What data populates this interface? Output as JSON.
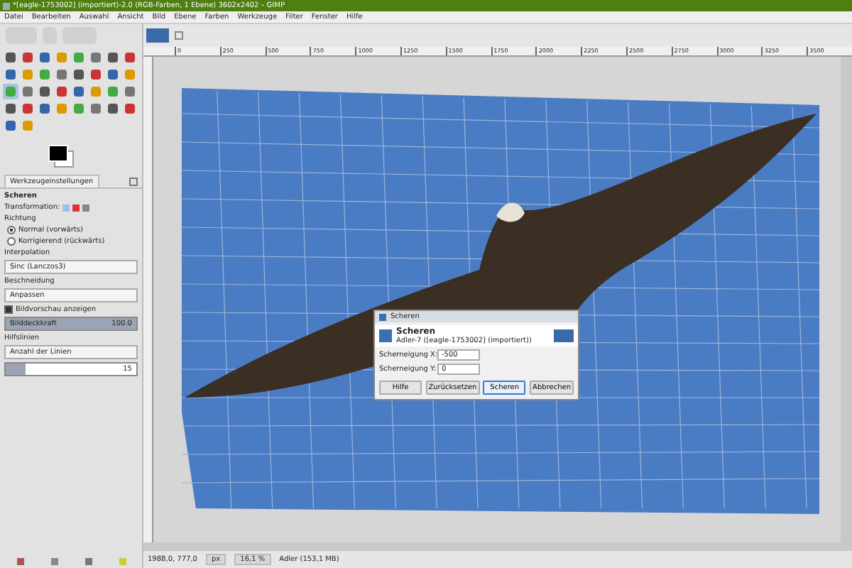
{
  "window": {
    "title": "*[eagle-1753002] (importiert)-2.0 (RGB-Farben, 1 Ebene) 3602x2402 – GIMP"
  },
  "menu": [
    "Datei",
    "Bearbeiten",
    "Auswahl",
    "Ansicht",
    "Bild",
    "Ebene",
    "Farben",
    "Werkzeuge",
    "Filter",
    "Fenster",
    "Hilfe"
  ],
  "tools": [
    {
      "selected": false
    },
    {
      "selected": false
    },
    {
      "selected": false
    },
    {
      "selected": false
    },
    {
      "selected": false
    },
    {
      "selected": false
    },
    {
      "selected": false
    },
    {
      "selected": false
    },
    {
      "selected": false
    },
    {
      "selected": false
    },
    {
      "selected": false
    },
    {
      "selected": false
    },
    {
      "selected": false
    },
    {
      "selected": false
    },
    {
      "selected": false
    },
    {
      "selected": false
    },
    {
      "selected": true
    },
    {
      "selected": false
    },
    {
      "selected": false
    },
    {
      "selected": false
    },
    {
      "selected": false
    },
    {
      "selected": false
    },
    {
      "selected": false
    },
    {
      "selected": false
    },
    {
      "selected": false
    },
    {
      "selected": false
    },
    {
      "selected": false
    },
    {
      "selected": false
    },
    {
      "selected": false
    },
    {
      "selected": false
    },
    {
      "selected": false
    },
    {
      "selected": false
    },
    {
      "selected": false
    },
    {
      "selected": false
    }
  ],
  "tool_options": {
    "tab": "Werkzeugeinstellungen",
    "tool": "Scheren",
    "transformation_label": "Transformation:",
    "direction_label": "Richtung",
    "directions": [
      {
        "label": "Normal (vorwärts)",
        "selected": true
      },
      {
        "label": "Korrigierend (rückwärts)",
        "selected": false
      }
    ],
    "interpolation_label": "Interpolation",
    "interpolation": "Sinc (Lanczos3)",
    "clipping_label": "Beschneidung",
    "clipping": "Anpassen",
    "preview": {
      "label": "Bildvorschau anzeigen",
      "checked": true
    },
    "opacity": {
      "label": "Bilddeckkraft",
      "value": "100.0",
      "level": 1
    },
    "guides_label": "Hilfslinien",
    "guides": "Anzahl der Linien",
    "lines": {
      "value": "15",
      "level": 0.15
    }
  },
  "ruler": [
    "0",
    "250",
    "500",
    "750",
    "1000",
    "1250",
    "1500",
    "1750",
    "2000",
    "2250",
    "2500",
    "2750",
    "3000",
    "3250",
    "3500"
  ],
  "dialog": {
    "title": "Scheren",
    "heading": "Scheren",
    "subtitle": "Adler-7 ([eagle-1753002] (importiert))",
    "fields": [
      {
        "label": "Scherneigung X:",
        "value": "-500"
      },
      {
        "label": "Scherneigung Y:",
        "value": "0"
      }
    ],
    "buttons": [
      {
        "label": "Hilfe",
        "focused": false
      },
      {
        "label": "Zurücksetzen",
        "focused": false
      },
      {
        "label": "Scheren",
        "focused": true
      },
      {
        "label": "Abbrechen",
        "focused": false
      }
    ]
  },
  "status_bar": {
    "coords": "1988,0, 777,0",
    "unit": "px",
    "zoom": "16,1 %",
    "info": "Adler (153,1 MB)"
  }
}
